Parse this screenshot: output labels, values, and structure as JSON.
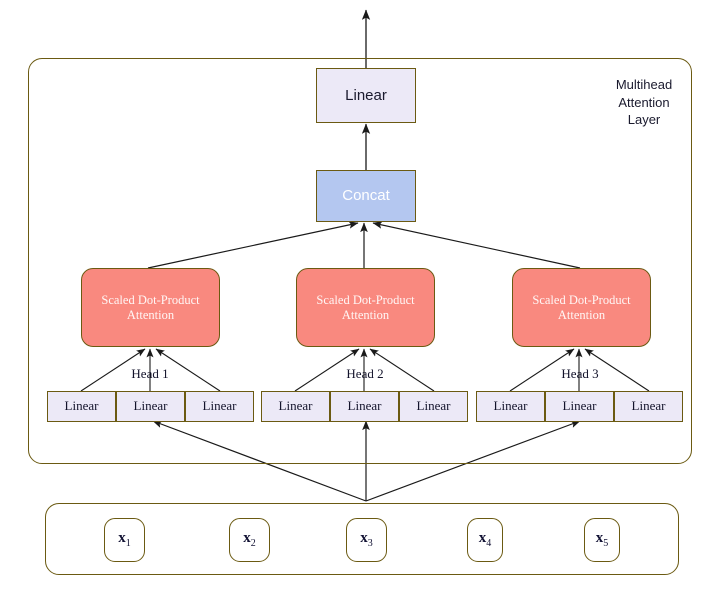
{
  "diagram": {
    "title": "Multihead Attention Layer",
    "side_label": "Multihead\nAttention\nLayer",
    "colors": {
      "attention_fill": "#F9897F",
      "concat_fill": "#B4C7F0",
      "linear_fill": "#ECE9F7",
      "border": "#6B5A12",
      "arrow": "#1A1A1A",
      "text_dark": "#13132B",
      "text_light": "#FFFFFF"
    },
    "output_linear": {
      "label": "Linear"
    },
    "concat": {
      "label": "Concat"
    },
    "heads": [
      {
        "name": "Head 1",
        "attention_label": "Scaled Dot-Product\nAttention",
        "attention_line1": "Scaled Dot-Product",
        "attention_line2": "Attention",
        "projections": [
          {
            "label": "Linear"
          },
          {
            "label": "Linear"
          },
          {
            "label": "Linear"
          }
        ]
      },
      {
        "name": "Head 2",
        "attention_label": "Scaled Dot-Product\nAttention",
        "attention_line1": "Scaled Dot-Product",
        "attention_line2": "Attention",
        "projections": [
          {
            "label": "Linear"
          },
          {
            "label": "Linear"
          },
          {
            "label": "Linear"
          }
        ]
      },
      {
        "name": "Head 3",
        "attention_label": "Scaled Dot-Product\nAttention",
        "attention_line1": "Scaled Dot-Product",
        "attention_line2": "Attention",
        "projections": [
          {
            "label": "Linear"
          },
          {
            "label": "Linear"
          },
          {
            "label": "Linear"
          }
        ]
      }
    ],
    "inputs": [
      {
        "symbol": "x",
        "index": "1"
      },
      {
        "symbol": "x",
        "index": "2"
      },
      {
        "symbol": "x",
        "index": "3"
      },
      {
        "symbol": "x",
        "index": "4"
      },
      {
        "symbol": "x",
        "index": "5"
      }
    ]
  }
}
